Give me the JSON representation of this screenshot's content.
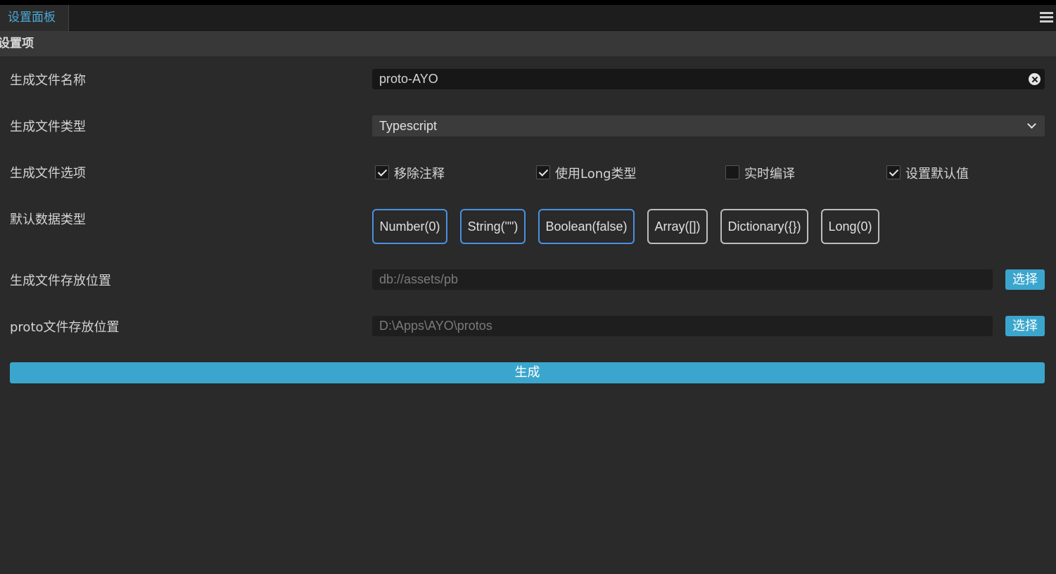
{
  "tab": {
    "title": "设置面板"
  },
  "section": {
    "title": "设置项"
  },
  "fields": {
    "file_name": {
      "label": "生成文件名称",
      "value": "proto-AYO"
    },
    "file_type": {
      "label": "生成文件类型",
      "value": "Typescript"
    },
    "file_options": {
      "label": "生成文件选项",
      "items": [
        {
          "label": "移除注释",
          "checked": true
        },
        {
          "label": "使用Long类型",
          "checked": true
        },
        {
          "label": "实时编译",
          "checked": false
        },
        {
          "label": "设置默认值",
          "checked": true
        }
      ]
    },
    "default_types": {
      "label": "默认数据类型",
      "items": [
        {
          "label": "Number(0)",
          "selected": true
        },
        {
          "label": "String(\"\")",
          "selected": true
        },
        {
          "label": "Boolean(false)",
          "selected": true
        },
        {
          "label": "Array([])",
          "selected": false
        },
        {
          "label": "Dictionary({})",
          "selected": false
        },
        {
          "label": "Long(0)",
          "selected": false
        }
      ]
    },
    "output_path": {
      "label": "生成文件存放位置",
      "placeholder": "db://assets/pb",
      "button": "选择"
    },
    "proto_path": {
      "label": "proto文件存放位置",
      "placeholder": "D:\\Apps\\AYO\\protos",
      "button": "选择"
    }
  },
  "generate_button": "生成",
  "colors": {
    "accent": "#3ba6cd",
    "chip_active": "#4a90e2",
    "tab_text": "#4da9d6"
  }
}
